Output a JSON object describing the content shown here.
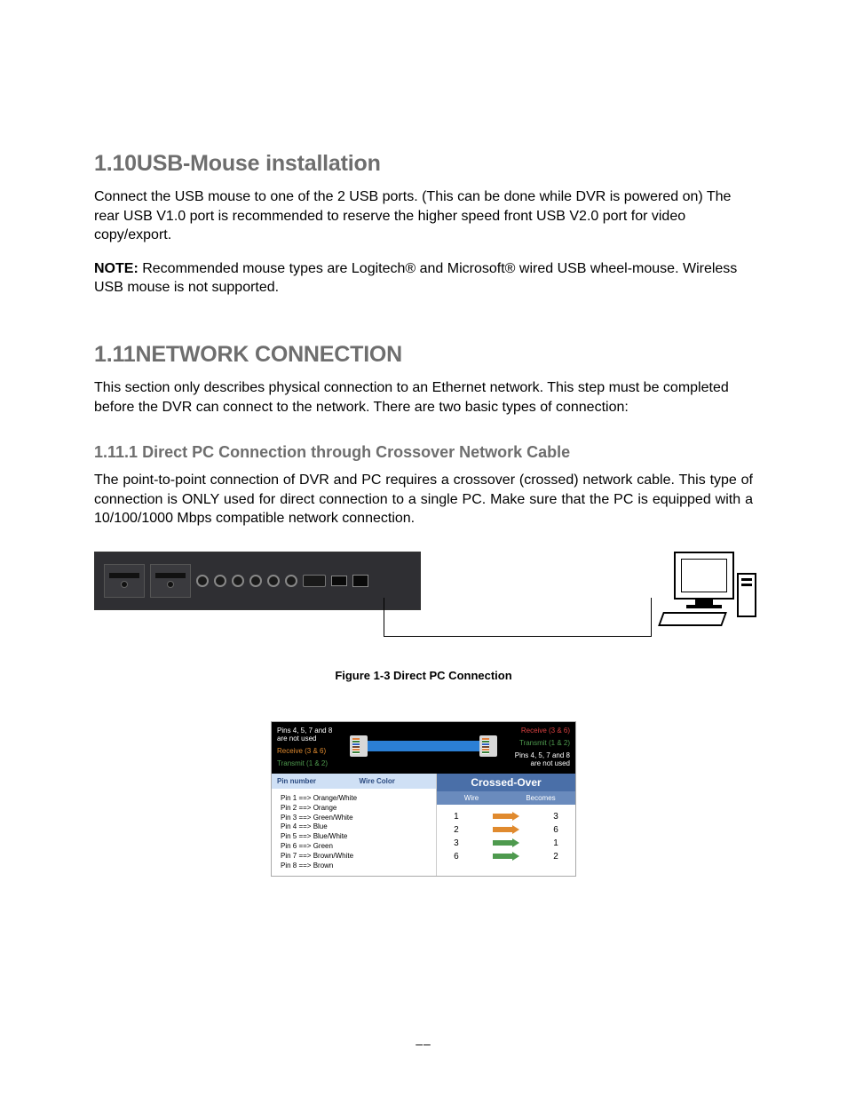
{
  "section_110": {
    "num": "1.10",
    "title": "USB-Mouse installation",
    "para1": "Connect the USB mouse to one of the 2 USB ports. (This can be done while DVR is powered on) The rear USB V1.0 port is recommended to reserve the higher speed front USB V2.0 port for video copy/export.",
    "note_label": "NOTE:",
    "note_text": " Recommended mouse types are Logitech® and Microsoft® wired USB wheel-mouse. Wireless USB mouse is not supported."
  },
  "section_111": {
    "num": "1.11",
    "title": "NETWORK CONNECTION",
    "para1": "This section only describes physical connection to an Ethernet network. This step must be completed before the DVR can connect to the network. There are two basic types of connection:"
  },
  "section_1111": {
    "num": "1.11.1",
    "title": "Direct PC Connection through Crossover Network Cable",
    "para1": "The point-to-point connection of DVR and PC requires a crossover (crossed) network cable. This type of connection is ONLY used for direct connection to a single PC. Make sure that the PC is equipped with a 10/100/1000 Mbps compatible network connection."
  },
  "figure_caption": "Figure 1-3 Direct PC Connection",
  "crossover": {
    "top_left": {
      "l1": "Pins 4, 5, 7 and 8",
      "l2": "are not used",
      "l3": "Receive (3 & 6)",
      "l4": "Transmit (1 & 2)"
    },
    "top_right": {
      "l1": "Receive (3 & 6)",
      "l2": "Transmit (1 & 2)",
      "l3": "Pins 4, 5, 7 and 8",
      "l4": "are not used"
    },
    "pin_hdr": "Pin number",
    "color_hdr": "Wire Color",
    "pins": [
      "Pin 1 ==> Orange/White",
      "Pin 2 ==> Orange",
      "Pin 3 ==> Green/White",
      "Pin 4 ==> Blue",
      "Pin 5 ==> Blue/White",
      "Pin 6 ==> Green",
      "Pin 7 ==> Brown/White",
      "Pin 8 ==> Brown"
    ],
    "crossed_hdr": "Crossed-Over",
    "wire_hdr": "Wire",
    "becomes_hdr": "Becomes",
    "map": [
      {
        "from": "1",
        "to": "3",
        "color": "#e08a2e"
      },
      {
        "from": "2",
        "to": "6",
        "color": "#e08a2e"
      },
      {
        "from": "3",
        "to": "1",
        "color": "#4e9a4e"
      },
      {
        "from": "6",
        "to": "2",
        "color": "#4e9a4e"
      }
    ]
  },
  "footer": "––"
}
